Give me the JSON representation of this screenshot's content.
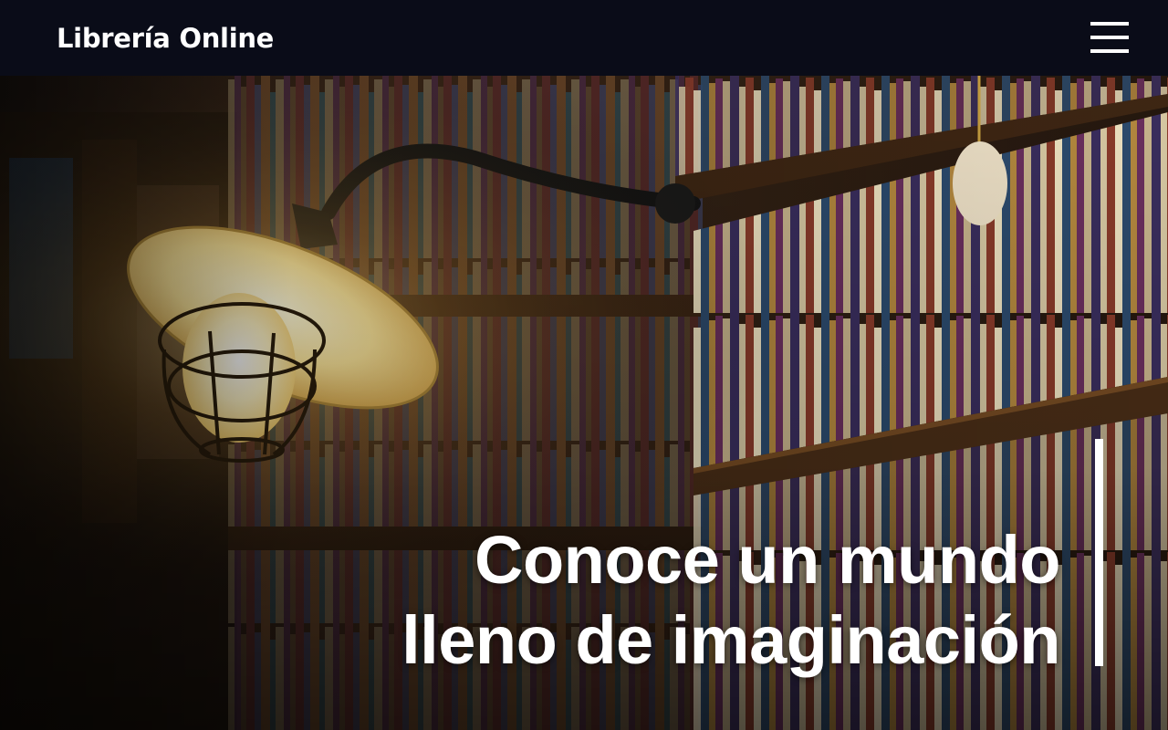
{
  "header": {
    "brand": "Librería Online",
    "menu_icon": "hamburger-menu-icon"
  },
  "hero": {
    "image": "bookshelf-lamp-image",
    "title_line1": "Conoce un mundo",
    "title_line2": "lleno de imaginación"
  },
  "colors": {
    "navbar_bg": "#0a0c18",
    "text": "#ffffff",
    "lamp_glow": "#ffd66a"
  }
}
